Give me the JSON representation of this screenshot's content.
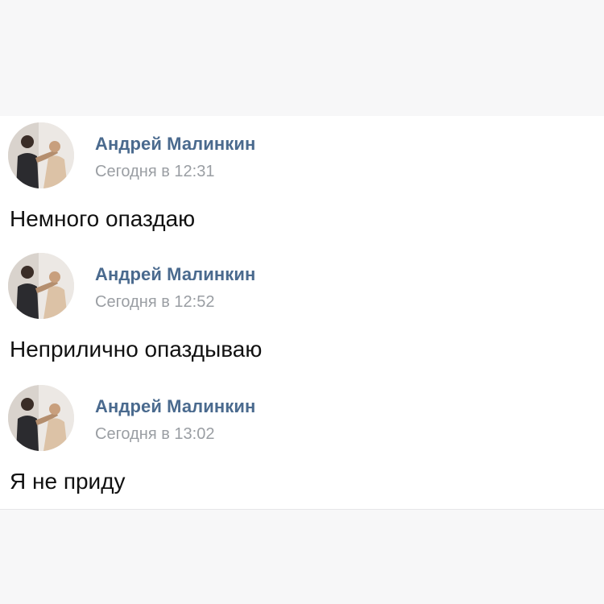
{
  "feed": {
    "posts": [
      {
        "author": "Андрей Малинкин",
        "time": "Сегодня в 12:31",
        "message": "Немного опаздаю"
      },
      {
        "author": "Андрей Малинкин",
        "time": "Сегодня в 12:52",
        "message": "Неприлично опаздываю"
      },
      {
        "author": "Андрей Малинкин",
        "time": "Сегодня в 13:02",
        "message": "Я не приду"
      }
    ]
  },
  "colors": {
    "author_link": "#4a6a8e",
    "timestamp": "#9a9ea3",
    "message_text": "#111111",
    "panel_background": "#ffffff",
    "page_background": "#f7f7f8"
  }
}
